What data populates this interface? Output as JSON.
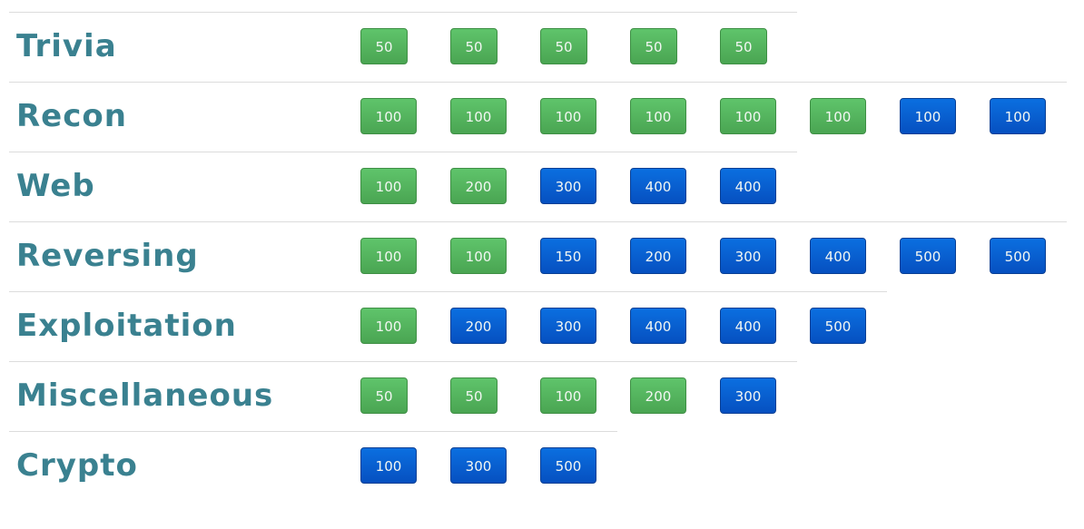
{
  "colors": {
    "category_title": "#3a8190",
    "unsolved": "#52b25d",
    "solved": "#0660cf",
    "divider": "#dcdcdc"
  },
  "categories": [
    {
      "name": "Trivia",
      "challenges": [
        {
          "value": "50",
          "state": "unsolved"
        },
        {
          "value": "50",
          "state": "unsolved"
        },
        {
          "value": "50",
          "state": "unsolved"
        },
        {
          "value": "50",
          "state": "unsolved"
        },
        {
          "value": "50",
          "state": "unsolved"
        }
      ]
    },
    {
      "name": "Recon",
      "challenges": [
        {
          "value": "100",
          "state": "unsolved"
        },
        {
          "value": "100",
          "state": "unsolved"
        },
        {
          "value": "100",
          "state": "unsolved"
        },
        {
          "value": "100",
          "state": "unsolved"
        },
        {
          "value": "100",
          "state": "unsolved"
        },
        {
          "value": "100",
          "state": "unsolved"
        },
        {
          "value": "100",
          "state": "solved"
        },
        {
          "value": "100",
          "state": "solved"
        }
      ]
    },
    {
      "name": "Web",
      "challenges": [
        {
          "value": "100",
          "state": "unsolved"
        },
        {
          "value": "200",
          "state": "unsolved"
        },
        {
          "value": "300",
          "state": "solved"
        },
        {
          "value": "400",
          "state": "solved"
        },
        {
          "value": "400",
          "state": "solved"
        }
      ]
    },
    {
      "name": "Reversing",
      "challenges": [
        {
          "value": "100",
          "state": "unsolved"
        },
        {
          "value": "100",
          "state": "unsolved"
        },
        {
          "value": "150",
          "state": "solved"
        },
        {
          "value": "200",
          "state": "solved"
        },
        {
          "value": "300",
          "state": "solved"
        },
        {
          "value": "400",
          "state": "solved"
        },
        {
          "value": "500",
          "state": "solved"
        },
        {
          "value": "500",
          "state": "solved"
        }
      ]
    },
    {
      "name": "Exploitation",
      "challenges": [
        {
          "value": "100",
          "state": "unsolved"
        },
        {
          "value": "200",
          "state": "solved"
        },
        {
          "value": "300",
          "state": "solved"
        },
        {
          "value": "400",
          "state": "solved"
        },
        {
          "value": "400",
          "state": "solved"
        },
        {
          "value": "500",
          "state": "solved"
        }
      ]
    },
    {
      "name": "Miscellaneous",
      "challenges": [
        {
          "value": "50",
          "state": "unsolved"
        },
        {
          "value": "50",
          "state": "unsolved"
        },
        {
          "value": "100",
          "state": "unsolved"
        },
        {
          "value": "200",
          "state": "unsolved"
        },
        {
          "value": "300",
          "state": "solved"
        }
      ]
    },
    {
      "name": "Crypto",
      "challenges": [
        {
          "value": "100",
          "state": "solved"
        },
        {
          "value": "300",
          "state": "solved"
        },
        {
          "value": "500",
          "state": "solved"
        }
      ]
    }
  ]
}
